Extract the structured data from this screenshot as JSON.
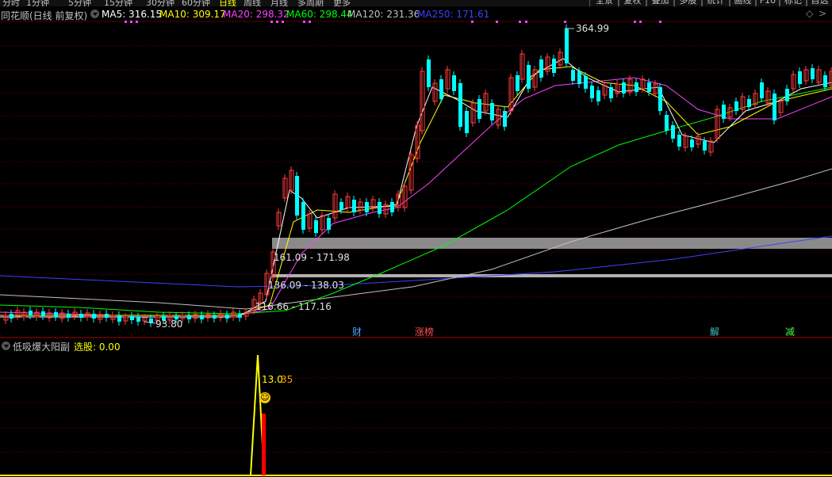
{
  "app": {
    "name": "同花顺(日线 前复权)"
  },
  "periods": [
    "分时",
    "1分钟",
    "5分钟",
    "15分钟",
    "30分钟",
    "60分钟",
    "日线",
    "周线",
    "月线",
    "多周期",
    "更多"
  ],
  "active_period": "日线",
  "right_tabs": [
    "全景",
    "复权",
    "叠加",
    "多股",
    "统计",
    "画线",
    "F10",
    "标记",
    "自选"
  ],
  "ma_legend": [
    {
      "label": "MA5: 316.15",
      "color": "#ffffff"
    },
    {
      "label": "MA10: 309.17",
      "color": "#ffff00"
    },
    {
      "label": "MA20: 298.32",
      "color": "#ff40ff"
    },
    {
      "label": "MA60: 298.44",
      "color": "#00ff00"
    },
    {
      "label": "MA120: 231.36",
      "color": "#c0c0c0"
    },
    {
      "label": "MA250: 171.61",
      "color": "#4040ff"
    }
  ],
  "annotations": {
    "high": "364.99",
    "low": "93.80",
    "bands": [
      "161.09 - 171.98",
      "136.09 - 138.03",
      "116.66 - 117.16"
    ]
  },
  "events": [
    {
      "label": "财",
      "color": "#4aa0ff"
    },
    {
      "label": "涨榜",
      "color": "#ff5050"
    },
    {
      "label": "解",
      "color": "#40c0c0"
    },
    {
      "label": "减",
      "color": "#40ff40"
    }
  ],
  "indicator": {
    "name": "低吸爆大阳副",
    "signal_label": "选股: 0.00",
    "value_label": "13.0",
    "value_suffix": "35"
  },
  "colors": {
    "up": "#ff3c3c",
    "down": "#00ffff",
    "grid": "#7a0000",
    "band": "#8a8a8a"
  }
}
